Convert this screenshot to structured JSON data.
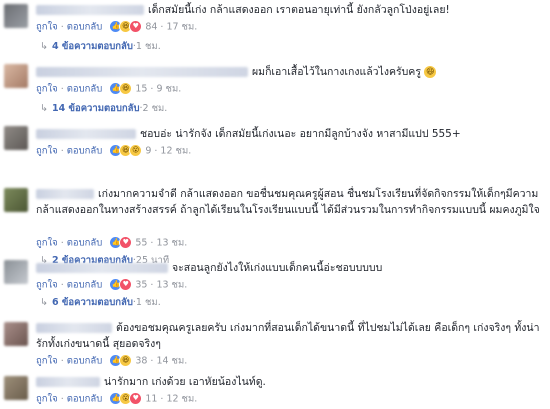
{
  "ui": {
    "like_label": "ถูกใจ",
    "reply_label": "ตอบกลับ",
    "sep": "·",
    "arrow": "↳"
  },
  "comments": [
    {
      "text": "เด็กสมัยนี้เก่ง กล้าแสดงออก เราตอนอายุเท่านี้ ยังกลัวลูกโป่งอยู่เลย!",
      "reaction_count": "84",
      "time": "17 ชม.",
      "replies_label": "4 ข้อความตอบกลับ",
      "replies_time": "1 ชม."
    },
    {
      "text": "ผมก็เอาเสื้อไว้ในกางเกงแล้วไงครับครู",
      "trailing_emoji": "😂",
      "reaction_count": "15",
      "time": "9 ชม.",
      "replies_label": "14 ข้อความตอบกลับ",
      "replies_time": "2 ชม."
    },
    {
      "text": "ชอบอ่ะ น่ารักจัง เด็กสมัยนี้เก่งเนอะ อยากมีลูกบ้างจัง หาสามีแปป 555+",
      "reaction_count": "9",
      "time": "12 ชม."
    },
    {
      "text": "เก่งมากความจำดี กล้าแสดงออก ขอชื่นชมคุณครูผู้สอน ชื่นชมโรงเรียนที่จัดกิจกรรมให้เด็กๆมีความกล้าแสดงออกในทางสร้างสรรค์ ถ้าลูกได้เรียนในโรงเรียนแบบนี้ ได้มีส่วนรวมในการทำกิจกรรมแบบนี้ ผมคงภูมิใจ",
      "reaction_count": "55",
      "time": "13 ชม.",
      "replies_label": "2 ข้อความตอบกลับ",
      "replies_time": "25 นาที"
    },
    {
      "text": "จะสอนลูกยังไงให้เก่งแบบเด็กคนนี้อ่ะชอบบบบบ",
      "reaction_count": "35",
      "time": "13 ชม.",
      "replies_label": "6 ข้อความตอบกลับ",
      "replies_time": "1 ชม."
    },
    {
      "text": "ต้องขอชมคุณครูเลยครับ เก่งมากที่สอนเด็กได้ขนาดนี้ ที่ไปชมไม่ได้เลย คือเด็กๆ เก่งจริงๆ ทั้งน่ารักทั้งเก่งขนาดนี้ สุยอดจริงๆ",
      "reaction_count": "38",
      "time": "14 ชม."
    },
    {
      "text": "น่ารักมาก เก่งด้วย เอาหัยน้องไนท์ดู.",
      "reaction_count": "11",
      "time": "12 ชม."
    }
  ]
}
